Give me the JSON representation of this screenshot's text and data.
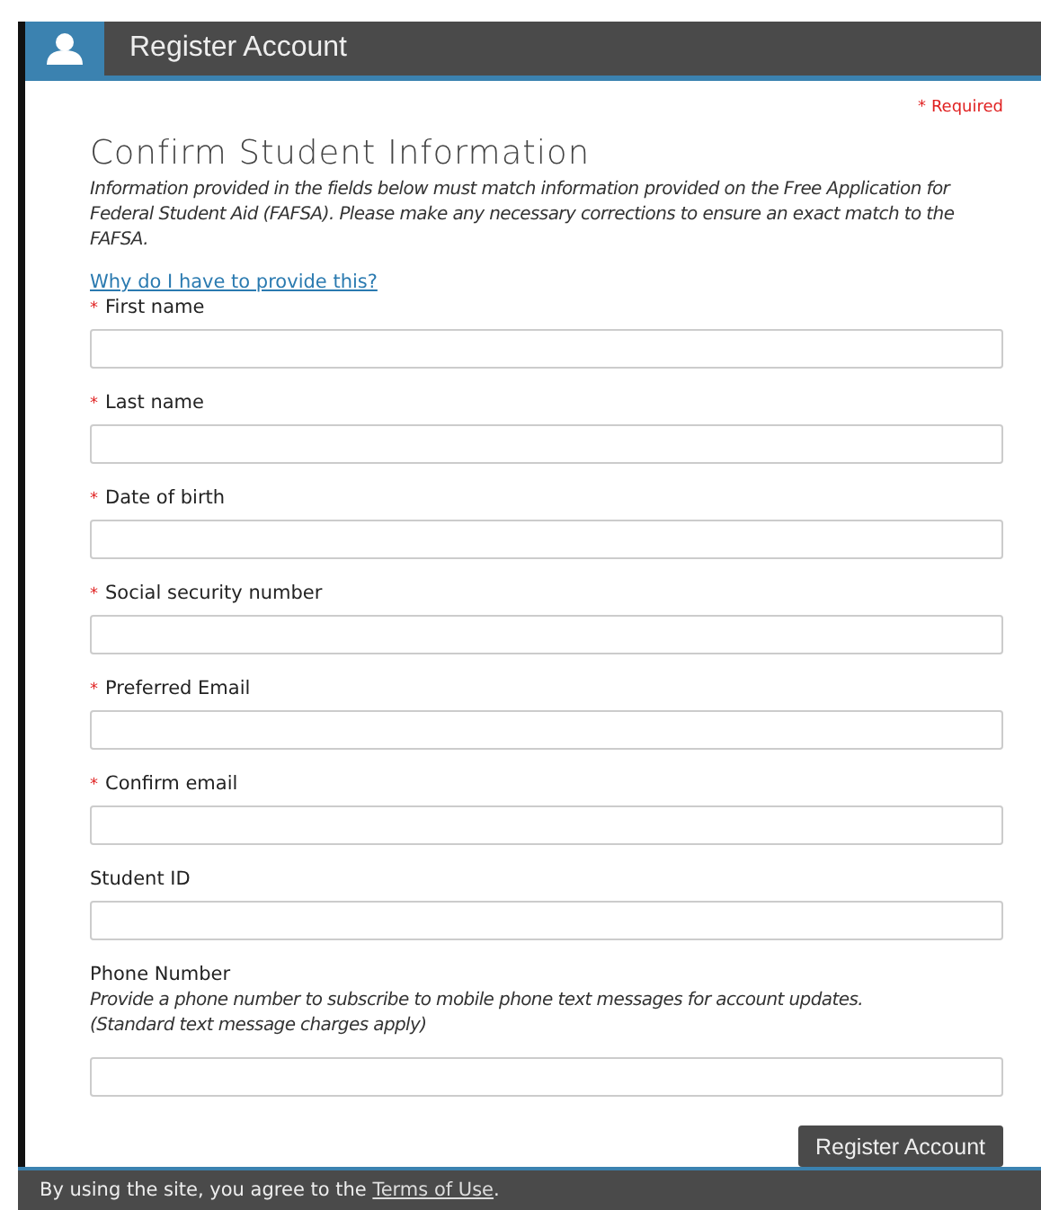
{
  "header": {
    "title": "Register Account"
  },
  "required_note": {
    "mark": "*",
    "text": "Required"
  },
  "form": {
    "title": "Confirm Student Information",
    "intro": "Information provided in the fields below must match information provided on the Free Application for Federal Student Aid (FAFSA). Please make any necessary corrections to ensure an exact match to the FAFSA.",
    "help_link": "Why do I have to provide this?",
    "fields": [
      {
        "label": "First name",
        "required": true
      },
      {
        "label": "Last name",
        "required": true
      },
      {
        "label": "Date of birth",
        "required": true
      },
      {
        "label": "Social security number",
        "required": true
      },
      {
        "label": "Preferred Email",
        "required": true
      },
      {
        "label": "Confirm email",
        "required": true
      },
      {
        "label": "Student ID",
        "required": false
      },
      {
        "label": "Phone Number",
        "required": false,
        "help": [
          "Provide a phone number to subscribe to mobile phone text messages for account updates.",
          "(Standard text message charges apply)"
        ]
      }
    ],
    "submit": "Register Account"
  },
  "footer": {
    "text": "By using the site, you agree to the",
    "link": "Terms of Use",
    "after": "."
  }
}
